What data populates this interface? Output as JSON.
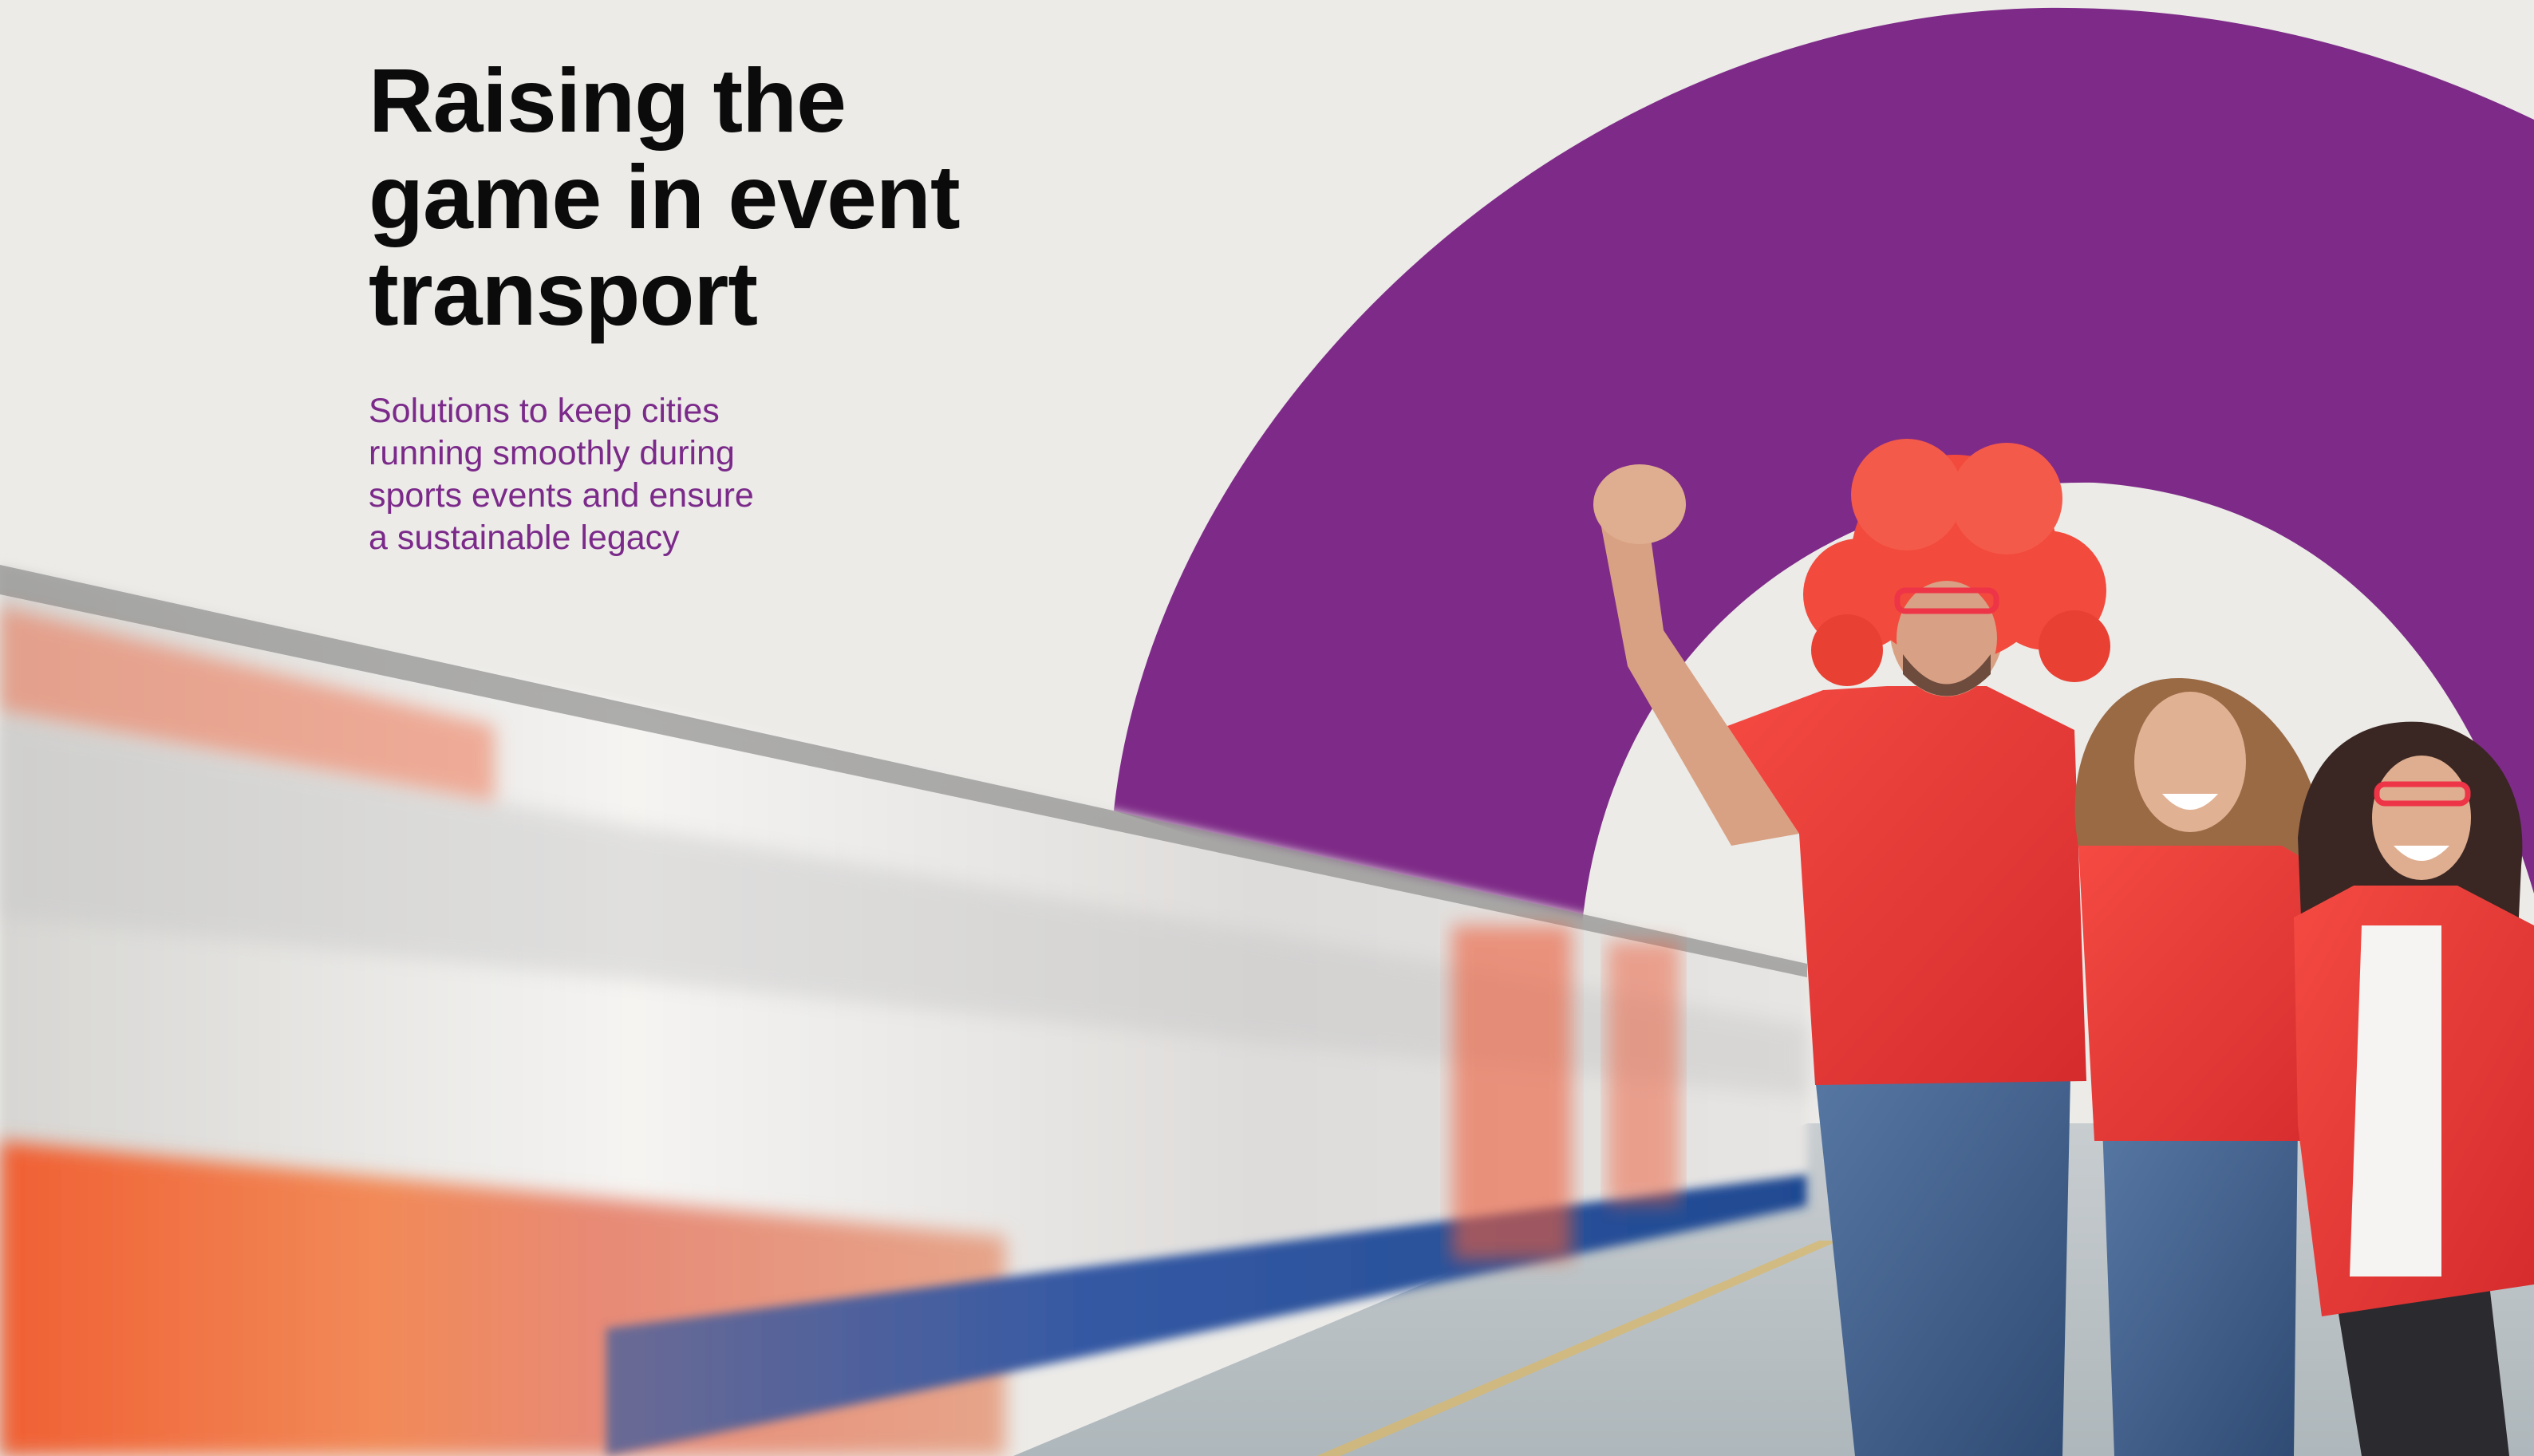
{
  "document": {
    "headline_lines": [
      "Raising the",
      "game in event",
      "transport"
    ],
    "subtitle_lines": [
      "Solutions to keep cities",
      "running smoothly during",
      "sports events and ensure",
      "a sustainable legacy"
    ]
  },
  "visual": {
    "brand_purple": "#7e2a88",
    "background": "#ecebe8",
    "train_orange": "#ee5a32",
    "train_blue": "#2b5aa8",
    "fan_red": "#e83b35",
    "wig_red": "#f04a3c",
    "denim_blue": "#3f5e8a"
  }
}
